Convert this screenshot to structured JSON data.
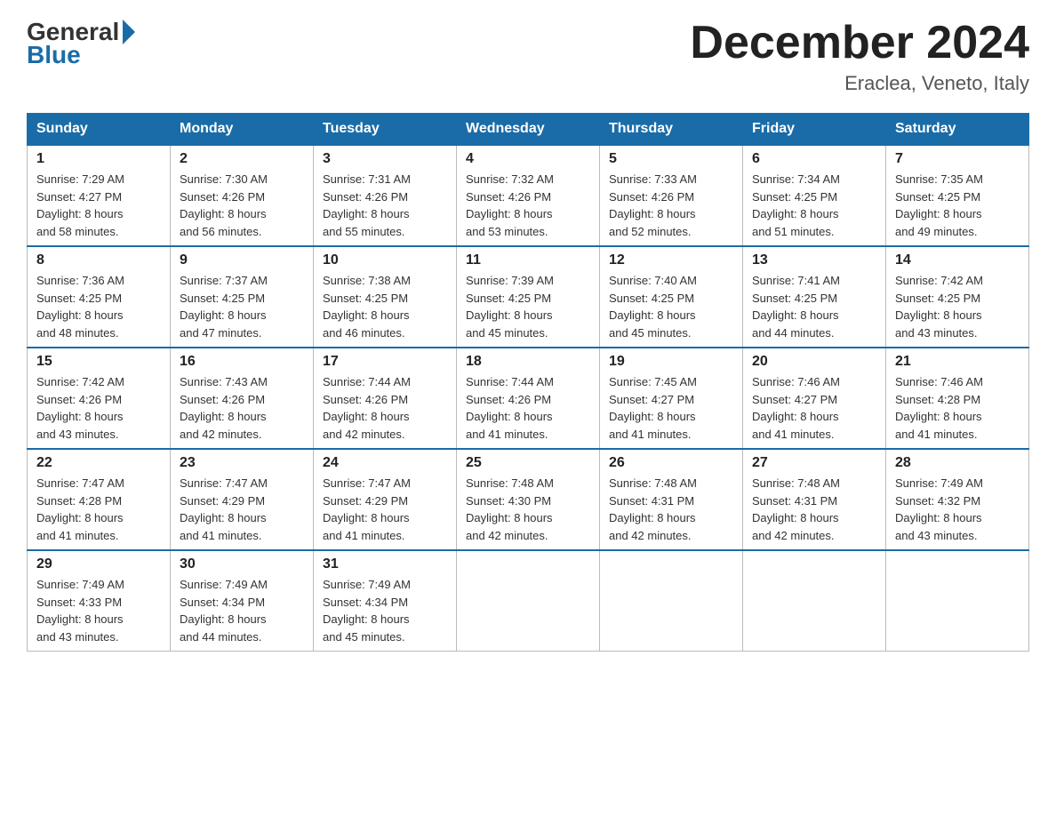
{
  "header": {
    "logo_general": "General",
    "logo_blue": "Blue",
    "month_title": "December 2024",
    "location": "Eraclea, Veneto, Italy"
  },
  "weekdays": [
    "Sunday",
    "Monday",
    "Tuesday",
    "Wednesday",
    "Thursday",
    "Friday",
    "Saturday"
  ],
  "weeks": [
    [
      {
        "day": "1",
        "sunrise": "7:29 AM",
        "sunset": "4:27 PM",
        "daylight": "8 hours and 58 minutes."
      },
      {
        "day": "2",
        "sunrise": "7:30 AM",
        "sunset": "4:26 PM",
        "daylight": "8 hours and 56 minutes."
      },
      {
        "day": "3",
        "sunrise": "7:31 AM",
        "sunset": "4:26 PM",
        "daylight": "8 hours and 55 minutes."
      },
      {
        "day": "4",
        "sunrise": "7:32 AM",
        "sunset": "4:26 PM",
        "daylight": "8 hours and 53 minutes."
      },
      {
        "day": "5",
        "sunrise": "7:33 AM",
        "sunset": "4:26 PM",
        "daylight": "8 hours and 52 minutes."
      },
      {
        "day": "6",
        "sunrise": "7:34 AM",
        "sunset": "4:25 PM",
        "daylight": "8 hours and 51 minutes."
      },
      {
        "day": "7",
        "sunrise": "7:35 AM",
        "sunset": "4:25 PM",
        "daylight": "8 hours and 49 minutes."
      }
    ],
    [
      {
        "day": "8",
        "sunrise": "7:36 AM",
        "sunset": "4:25 PM",
        "daylight": "8 hours and 48 minutes."
      },
      {
        "day": "9",
        "sunrise": "7:37 AM",
        "sunset": "4:25 PM",
        "daylight": "8 hours and 47 minutes."
      },
      {
        "day": "10",
        "sunrise": "7:38 AM",
        "sunset": "4:25 PM",
        "daylight": "8 hours and 46 minutes."
      },
      {
        "day": "11",
        "sunrise": "7:39 AM",
        "sunset": "4:25 PM",
        "daylight": "8 hours and 45 minutes."
      },
      {
        "day": "12",
        "sunrise": "7:40 AM",
        "sunset": "4:25 PM",
        "daylight": "8 hours and 45 minutes."
      },
      {
        "day": "13",
        "sunrise": "7:41 AM",
        "sunset": "4:25 PM",
        "daylight": "8 hours and 44 minutes."
      },
      {
        "day": "14",
        "sunrise": "7:42 AM",
        "sunset": "4:25 PM",
        "daylight": "8 hours and 43 minutes."
      }
    ],
    [
      {
        "day": "15",
        "sunrise": "7:42 AM",
        "sunset": "4:26 PM",
        "daylight": "8 hours and 43 minutes."
      },
      {
        "day": "16",
        "sunrise": "7:43 AM",
        "sunset": "4:26 PM",
        "daylight": "8 hours and 42 minutes."
      },
      {
        "day": "17",
        "sunrise": "7:44 AM",
        "sunset": "4:26 PM",
        "daylight": "8 hours and 42 minutes."
      },
      {
        "day": "18",
        "sunrise": "7:44 AM",
        "sunset": "4:26 PM",
        "daylight": "8 hours and 41 minutes."
      },
      {
        "day": "19",
        "sunrise": "7:45 AM",
        "sunset": "4:27 PM",
        "daylight": "8 hours and 41 minutes."
      },
      {
        "day": "20",
        "sunrise": "7:46 AM",
        "sunset": "4:27 PM",
        "daylight": "8 hours and 41 minutes."
      },
      {
        "day": "21",
        "sunrise": "7:46 AM",
        "sunset": "4:28 PM",
        "daylight": "8 hours and 41 minutes."
      }
    ],
    [
      {
        "day": "22",
        "sunrise": "7:47 AM",
        "sunset": "4:28 PM",
        "daylight": "8 hours and 41 minutes."
      },
      {
        "day": "23",
        "sunrise": "7:47 AM",
        "sunset": "4:29 PM",
        "daylight": "8 hours and 41 minutes."
      },
      {
        "day": "24",
        "sunrise": "7:47 AM",
        "sunset": "4:29 PM",
        "daylight": "8 hours and 41 minutes."
      },
      {
        "day": "25",
        "sunrise": "7:48 AM",
        "sunset": "4:30 PM",
        "daylight": "8 hours and 42 minutes."
      },
      {
        "day": "26",
        "sunrise": "7:48 AM",
        "sunset": "4:31 PM",
        "daylight": "8 hours and 42 minutes."
      },
      {
        "day": "27",
        "sunrise": "7:48 AM",
        "sunset": "4:31 PM",
        "daylight": "8 hours and 42 minutes."
      },
      {
        "day": "28",
        "sunrise": "7:49 AM",
        "sunset": "4:32 PM",
        "daylight": "8 hours and 43 minutes."
      }
    ],
    [
      {
        "day": "29",
        "sunrise": "7:49 AM",
        "sunset": "4:33 PM",
        "daylight": "8 hours and 43 minutes."
      },
      {
        "day": "30",
        "sunrise": "7:49 AM",
        "sunset": "4:34 PM",
        "daylight": "8 hours and 44 minutes."
      },
      {
        "day": "31",
        "sunrise": "7:49 AM",
        "sunset": "4:34 PM",
        "daylight": "8 hours and 45 minutes."
      },
      null,
      null,
      null,
      null
    ]
  ],
  "labels": {
    "sunrise": "Sunrise:",
    "sunset": "Sunset:",
    "daylight": "Daylight:"
  }
}
